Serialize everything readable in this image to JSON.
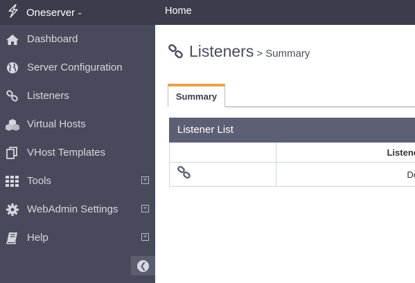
{
  "topbar": {
    "brand": "Oneserver",
    "brand_caret": "⌄",
    "brand_icon": "lightning-bolt-icon",
    "home": "Home"
  },
  "sidebar": {
    "items": [
      {
        "label": "Dashboard",
        "icon": "home-icon",
        "expandable": false
      },
      {
        "label": "Server Configuration",
        "icon": "globe-icon",
        "expandable": false
      },
      {
        "label": "Listeners",
        "icon": "link-icon",
        "expandable": false
      },
      {
        "label": "Virtual Hosts",
        "icon": "cubes-icon",
        "expandable": false
      },
      {
        "label": "VHost Templates",
        "icon": "copy-icon",
        "expandable": false
      },
      {
        "label": "Tools",
        "icon": "grid-icon",
        "expandable": true
      },
      {
        "label": "WebAdmin Settings",
        "icon": "gear-icon",
        "expandable": true
      },
      {
        "label": "Help",
        "icon": "book-icon",
        "expandable": true
      }
    ],
    "expand_symbol": "+",
    "collapse_symbol": "❮"
  },
  "main": {
    "title": "Listeners",
    "breadcrumb": "> Summary",
    "tabs": [
      {
        "label": "Summary",
        "active": true
      }
    ],
    "widget": {
      "title": "Listener List",
      "columns": [
        "",
        "Listene"
      ],
      "rows": [
        {
          "icon": "link-icon",
          "name": "De"
        }
      ]
    }
  },
  "colors": {
    "topbar": "#3b3d4c",
    "sidebar": "#484a5c",
    "widget_header": "#5d6075",
    "tab_accent": "#e8a24a"
  }
}
